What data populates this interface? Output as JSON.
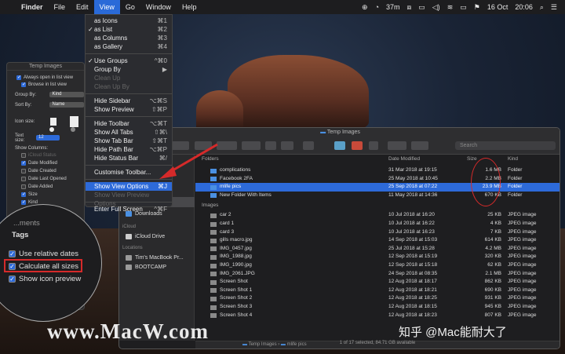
{
  "menubar": {
    "app": "Finder",
    "items": [
      "File",
      "Edit",
      "View",
      "Go",
      "Window",
      "Help"
    ],
    "status": {
      "timer": "37m",
      "date": "16 Oct",
      "time": "20:06"
    }
  },
  "view_menu": {
    "items": [
      {
        "label": "as Icons",
        "shortcut": "⌘1"
      },
      {
        "label": "as List",
        "shortcut": "⌘2",
        "checked": true
      },
      {
        "label": "as Columns",
        "shortcut": "⌘3"
      },
      {
        "label": "as Gallery",
        "shortcut": "⌘4"
      },
      {
        "label": "Use Groups",
        "shortcut": "^⌘0",
        "checked": true
      },
      {
        "label": "Group By",
        "shortcut": "▶"
      },
      {
        "label": "Clean Up",
        "disabled": true
      },
      {
        "label": "Clean Up By",
        "disabled": true
      },
      {
        "label": "Hide Sidebar",
        "shortcut": "⌥⌘S"
      },
      {
        "label": "Show Preview",
        "shortcut": "⇧⌘P"
      },
      {
        "label": "Hide Toolbar",
        "shortcut": "⌥⌘T"
      },
      {
        "label": "Show All Tabs",
        "shortcut": "⇧⌘\\"
      },
      {
        "label": "Show Tab Bar",
        "shortcut": "⇧⌘T"
      },
      {
        "label": "Hide Path Bar",
        "shortcut": "⌥⌘P"
      },
      {
        "label": "Hide Status Bar",
        "shortcut": "⌘/"
      },
      {
        "label": "Customise Toolbar..."
      },
      {
        "label": "Show View Options",
        "shortcut": "⌘J",
        "highlighted": true
      },
      {
        "label": "Show View Preview Options",
        "disabled": true
      },
      {
        "label": "Enter Full Screen",
        "shortcut": "^⌘F"
      }
    ]
  },
  "view_options": {
    "title": "Temp Images",
    "always_open": "Always open in list view",
    "browse": "Browse in list view",
    "group_by_label": "Group By:",
    "group_by_value": "Kind",
    "sort_by_label": "Sort By:",
    "sort_by_value": "Name",
    "icon_size_label": "Icon size:",
    "text_size_label": "Text size:",
    "text_size_value": "12",
    "show_columns_label": "Show Columns:",
    "columns": [
      {
        "label": "iCloud Status",
        "checked": false,
        "disabled": true
      },
      {
        "label": "Date Modified",
        "checked": true
      },
      {
        "label": "Date Created",
        "checked": false
      },
      {
        "label": "Date Last Opened",
        "checked": false
      },
      {
        "label": "Date Added",
        "checked": false
      },
      {
        "label": "Size",
        "checked": true
      },
      {
        "label": "Kind",
        "checked": true
      }
    ]
  },
  "magnifier": {
    "partial": "...ments",
    "heading": "Tags",
    "items": [
      {
        "label": "Use relative dates",
        "checked": true
      },
      {
        "label": "Calculate all sizes",
        "checked": true
      },
      {
        "label": "Show icon preview",
        "checked": true
      }
    ]
  },
  "finder": {
    "title": "Temp Images",
    "search_placeholder": "Search",
    "sidebar": [
      {
        "label": "Dropbox"
      },
      {
        "label": "Google Drive"
      },
      {
        "label": "Documents"
      },
      {
        "label": "Recent"
      },
      {
        "label": "Temp Images",
        "selected": true
      },
      {
        "label": "Downloads"
      }
    ],
    "icloud_heading": "iCloud",
    "icloud_items": [
      "iCloud Drive"
    ],
    "locations_heading": "Locations",
    "location_items": [
      "Tim's MacBook Pr...",
      "BOOTCAMP"
    ],
    "columns": [
      "Folders",
      "Date Modified",
      "Size",
      "Kind"
    ],
    "folders": [
      {
        "name": "complications",
        "date": "31 Mar 2018 at 19:15",
        "size": "1.6 MB",
        "kind": "Folder"
      },
      {
        "name": "Facebook 2FA",
        "date": "25 May 2018 at 10:45",
        "size": "2.2 MB",
        "kind": "Folder"
      },
      {
        "name": "mlife pics",
        "date": "25 Sep 2018 at 07:22",
        "size": "23.9 MB",
        "kind": "Folder",
        "selected": true
      },
      {
        "name": "New Folder With Items",
        "date": "11 May 2018 at 14:36",
        "size": "670 KB",
        "kind": "Folder"
      }
    ],
    "images_heading": "Images",
    "images": [
      {
        "name": "car 2",
        "date": "10 Jul 2018 at 16:20",
        "size": "25 KB",
        "kind": "JPEG image"
      },
      {
        "name": "card 1",
        "date": "10 Jul 2018 at 16:22",
        "size": "4 KB",
        "kind": "JPEG image"
      },
      {
        "name": "card 3",
        "date": "10 Jul 2018 at 16:23",
        "size": "7 KB",
        "kind": "JPEG image"
      },
      {
        "name": "gills macro.jpg",
        "date": "14 Sep 2018 at 15:03",
        "size": "614 KB",
        "kind": "JPEG image"
      },
      {
        "name": "IMG_0457.jpg",
        "date": "25 Jul 2018 at 15:28",
        "size": "4.2 MB",
        "kind": "JPEG image"
      },
      {
        "name": "IMG_1988.jpg",
        "date": "12 Sep 2018 at 15:19",
        "size": "320 KB",
        "kind": "JPEG image"
      },
      {
        "name": "IMG_1990.jpg",
        "date": "12 Sep 2018 at 15:18",
        "size": "62 KB",
        "kind": "JPEG image"
      },
      {
        "name": "IMG_2061.JPG",
        "date": "24 Sep 2018 at 08:35",
        "size": "2.1 MB",
        "kind": "JPEG image"
      },
      {
        "name": "Screen Shot",
        "date": "12 Aug 2018 at 18:17",
        "size": "862 KB",
        "kind": "JPEG image"
      },
      {
        "name": "Screen Shot 1",
        "date": "12 Aug 2018 at 18:21",
        "size": "690 KB",
        "kind": "JPEG image"
      },
      {
        "name": "Screen Shot 2",
        "date": "12 Aug 2018 at 18:25",
        "size": "931 KB",
        "kind": "JPEG image"
      },
      {
        "name": "Screen Shot 3",
        "date": "12 Aug 2018 at 18:15",
        "size": "945 KB",
        "kind": "JPEG image"
      },
      {
        "name": "Screen Shot 4",
        "date": "12 Aug 2018 at 18:23",
        "size": "807 KB",
        "kind": "JPEG image"
      }
    ],
    "path": [
      "Temp Images",
      "mlife pics"
    ],
    "status": "1 of 17 selected, 84.71 GB available"
  },
  "watermark": "www.MacW.com",
  "credit": "知乎 @Mac能耐大了"
}
